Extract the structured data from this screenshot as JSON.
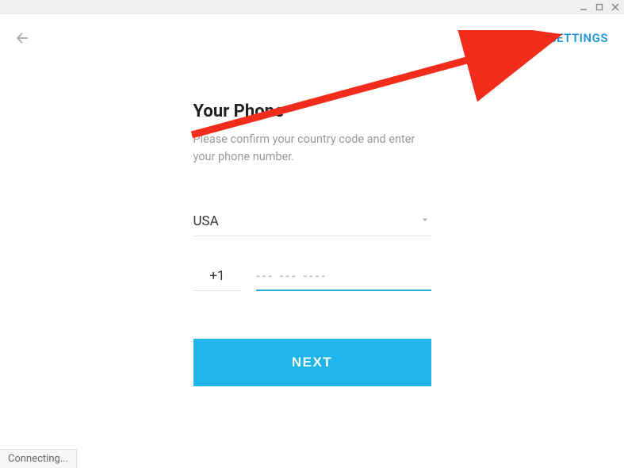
{
  "header": {
    "settings_label": "SETTINGS"
  },
  "page": {
    "title": "Your Phone",
    "subtitle": "Please confirm your country code and enter your phone number."
  },
  "country": {
    "selected": "USA"
  },
  "phone": {
    "code": "+1",
    "placeholder": "--- --- ----",
    "value": ""
  },
  "actions": {
    "next_label": "NEXT"
  },
  "status": {
    "text": "Connecting..."
  },
  "colors": {
    "accent": "#1fb5ea",
    "link": "#1f95d9"
  }
}
